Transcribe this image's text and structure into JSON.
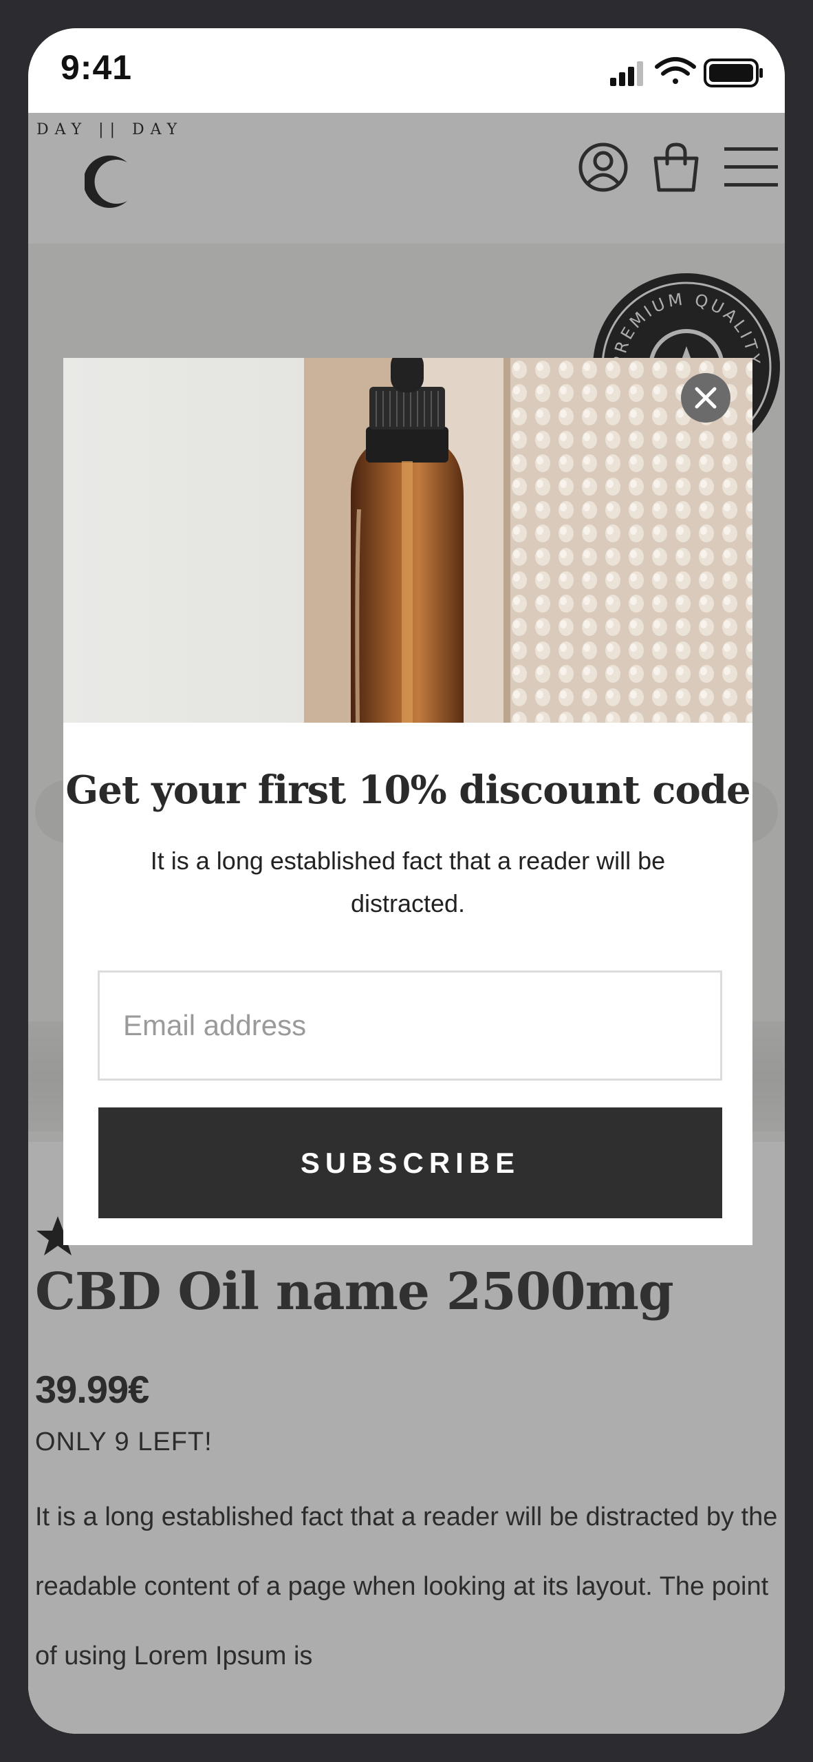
{
  "status_bar": {
    "time": "9:41"
  },
  "header": {
    "brand": "DAY || DAY"
  },
  "badge": {
    "text": "PREMIUM QUALITY"
  },
  "product": {
    "name": "CBD Oil name 2500mg",
    "price": "39.99€",
    "stock": "ONLY 9 LEFT!",
    "description": "It is a long established fact that a reader will be distracted by the readable content of a page when looking at its layout. The point of using Lorem Ipsum is"
  },
  "popup": {
    "title": "Get your first 10% discount code",
    "text": "It is a long established fact that a reader will be distracted.",
    "email_placeholder": "Email address",
    "subscribe_label": "SUBSCRIBE"
  },
  "colors": {
    "dark": "#2f2f2f",
    "overlay": "rgba(60,60,60,0.42)",
    "close": "#6b6b6b"
  }
}
